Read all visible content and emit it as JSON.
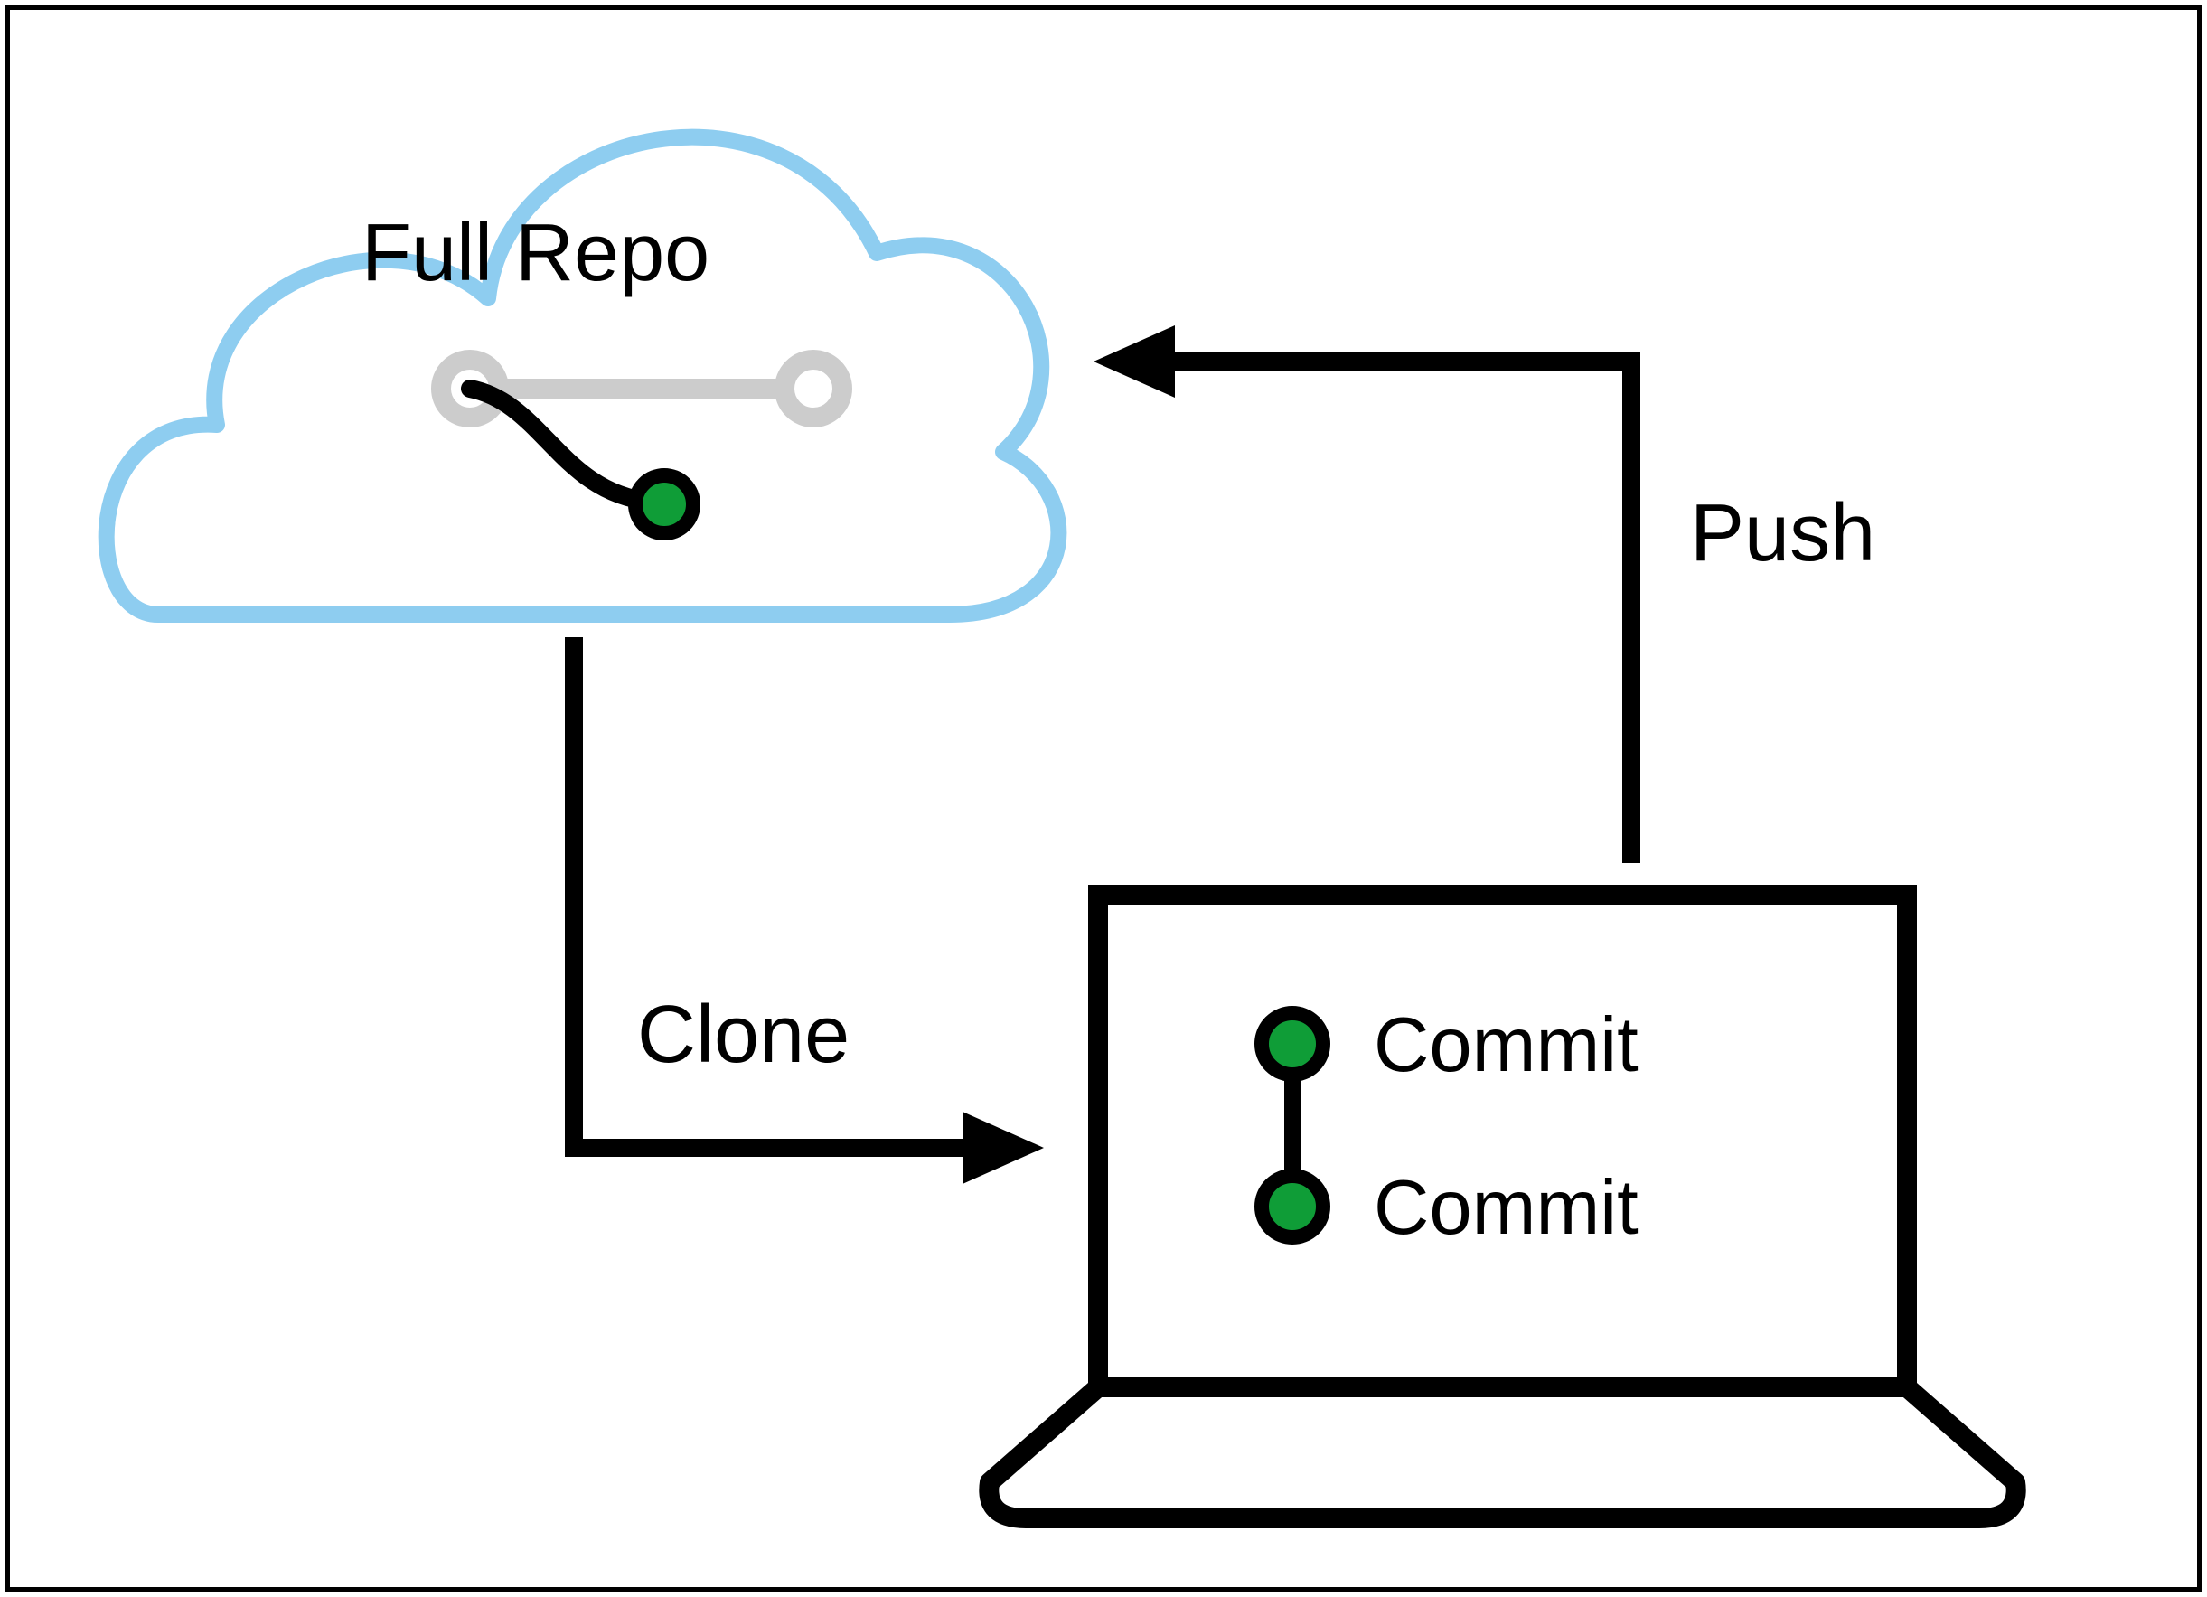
{
  "diagram": {
    "cloud_label": "Full Repo",
    "clone_label": "Clone",
    "push_label": "Push",
    "commit_label_1": "Commit",
    "commit_label_2": "Commit",
    "colors": {
      "cloud_stroke": "#8ecdf0",
      "commit_green": "#0f9d37",
      "branch_grey": "#cccccc",
      "black": "#000000"
    }
  }
}
